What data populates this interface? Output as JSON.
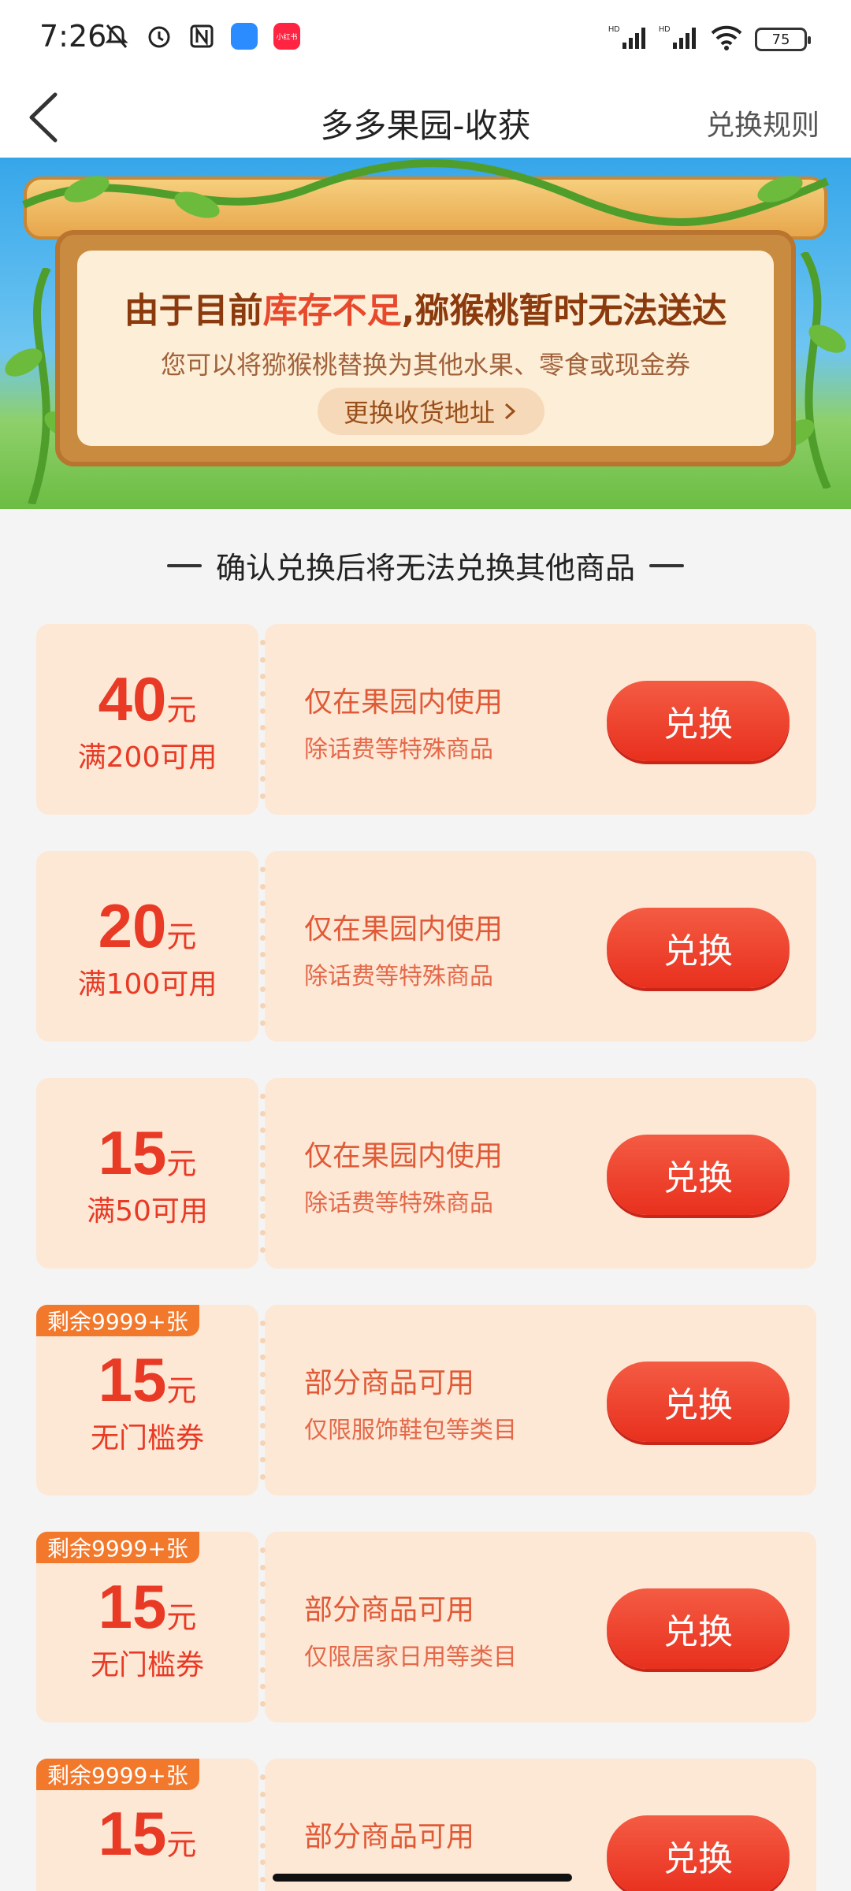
{
  "status_bar": {
    "time": "7:26",
    "battery": "75",
    "left_icons": [
      "bell-off-icon",
      "alarm-icon",
      "nfc-icon",
      "app-icon-blue",
      "app-icon-red"
    ],
    "right_icons": [
      "hd-signal-icon",
      "hd-signal-icon",
      "wifi-icon",
      "battery-icon"
    ],
    "red_app_label": "小红书"
  },
  "header": {
    "title": "多多果园-收获",
    "rules_label": "兑换规则"
  },
  "banner": {
    "line1_a": "由于目前",
    "line1_highlight": "库存不足",
    "line1_b": ",猕猴桃暂时无法送达",
    "line2": "您可以将猕猴桃替换为其他水果、零食或现金券",
    "change_address_label": "更换收货地址"
  },
  "section_title": "确认兑换后将无法兑换其他商品",
  "coupons": [
    {
      "amount": "40",
      "unit": "元",
      "condition": "满200可用",
      "desc1": "仅在果园内使用",
      "desc2": "除话费等特殊商品",
      "button": "兑换",
      "remaining": ""
    },
    {
      "amount": "20",
      "unit": "元",
      "condition": "满100可用",
      "desc1": "仅在果园内使用",
      "desc2": "除话费等特殊商品",
      "button": "兑换",
      "remaining": ""
    },
    {
      "amount": "15",
      "unit": "元",
      "condition": "满50可用",
      "desc1": "仅在果园内使用",
      "desc2": "除话费等特殊商品",
      "button": "兑换",
      "remaining": ""
    },
    {
      "amount": "15",
      "unit": "元",
      "condition": "无门槛券",
      "desc1": "部分商品可用",
      "desc2": "仅限服饰鞋包等类目",
      "button": "兑换",
      "remaining": "剩余9999+张"
    },
    {
      "amount": "15",
      "unit": "元",
      "condition": "无门槛券",
      "desc1": "部分商品可用",
      "desc2": "仅限居家日用等类目",
      "button": "兑换",
      "remaining": "剩余9999+张"
    },
    {
      "amount": "15",
      "unit": "元",
      "condition": "",
      "desc1": "部分商品可用",
      "desc2": "",
      "button": "兑换",
      "remaining": "剩余9999+张"
    }
  ],
  "colors": {
    "accent_red": "#e83a25",
    "coupon_bg": "#fde8d6",
    "badge_orange": "#f2782c"
  }
}
